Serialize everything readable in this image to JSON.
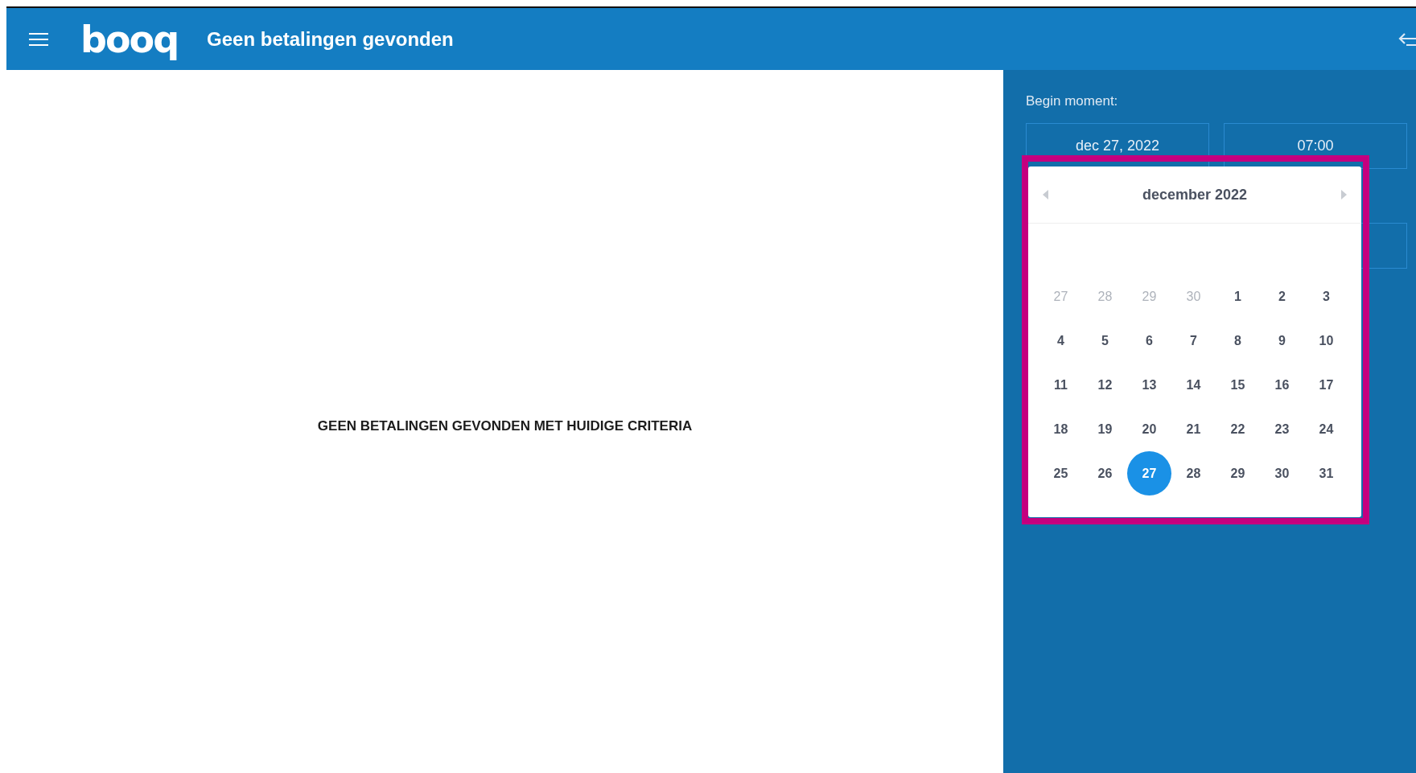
{
  "header": {
    "logo": "booq",
    "title": "Geen betalingen gevonden"
  },
  "main": {
    "message": "GEEN BETALINGEN GEVONDEN MET HUIDIGE CRITERIA"
  },
  "panel": {
    "label": "Begin moment:",
    "date_field": {
      "value": "dec 27, 2022"
    },
    "time_field": {
      "value": "07:00"
    },
    "calendar": {
      "month": "december 2022",
      "weeks": [
        [
          {
            "label": "27",
            "outside": true,
            "selected": false
          },
          {
            "label": "28",
            "outside": true,
            "selected": false
          },
          {
            "label": "29",
            "outside": true,
            "selected": false
          },
          {
            "label": "30",
            "outside": true,
            "selected": false
          },
          {
            "label": "1",
            "outside": false,
            "selected": false
          },
          {
            "label": "2",
            "outside": false,
            "selected": false
          },
          {
            "label": "3",
            "outside": false,
            "selected": false
          }
        ],
        [
          {
            "label": "4",
            "outside": false,
            "selected": false
          },
          {
            "label": "5",
            "outside": false,
            "selected": false
          },
          {
            "label": "6",
            "outside": false,
            "selected": false
          },
          {
            "label": "7",
            "outside": false,
            "selected": false
          },
          {
            "label": "8",
            "outside": false,
            "selected": false
          },
          {
            "label": "9",
            "outside": false,
            "selected": false
          },
          {
            "label": "10",
            "outside": false,
            "selected": false
          }
        ],
        [
          {
            "label": "11",
            "outside": false,
            "selected": false
          },
          {
            "label": "12",
            "outside": false,
            "selected": false
          },
          {
            "label": "13",
            "outside": false,
            "selected": false
          },
          {
            "label": "14",
            "outside": false,
            "selected": false
          },
          {
            "label": "15",
            "outside": false,
            "selected": false
          },
          {
            "label": "16",
            "outside": false,
            "selected": false
          },
          {
            "label": "17",
            "outside": false,
            "selected": false
          }
        ],
        [
          {
            "label": "18",
            "outside": false,
            "selected": false
          },
          {
            "label": "19",
            "outside": false,
            "selected": false
          },
          {
            "label": "20",
            "outside": false,
            "selected": false
          },
          {
            "label": "21",
            "outside": false,
            "selected": false
          },
          {
            "label": "22",
            "outside": false,
            "selected": false
          },
          {
            "label": "23",
            "outside": false,
            "selected": false
          },
          {
            "label": "24",
            "outside": false,
            "selected": false
          }
        ],
        [
          {
            "label": "25",
            "outside": false,
            "selected": false
          },
          {
            "label": "26",
            "outside": false,
            "selected": false
          },
          {
            "label": "27",
            "outside": false,
            "selected": true
          },
          {
            "label": "28",
            "outside": false,
            "selected": false
          },
          {
            "label": "29",
            "outside": false,
            "selected": false
          },
          {
            "label": "30",
            "outside": false,
            "selected": false
          },
          {
            "label": "31",
            "outside": false,
            "selected": false
          }
        ]
      ]
    }
  }
}
